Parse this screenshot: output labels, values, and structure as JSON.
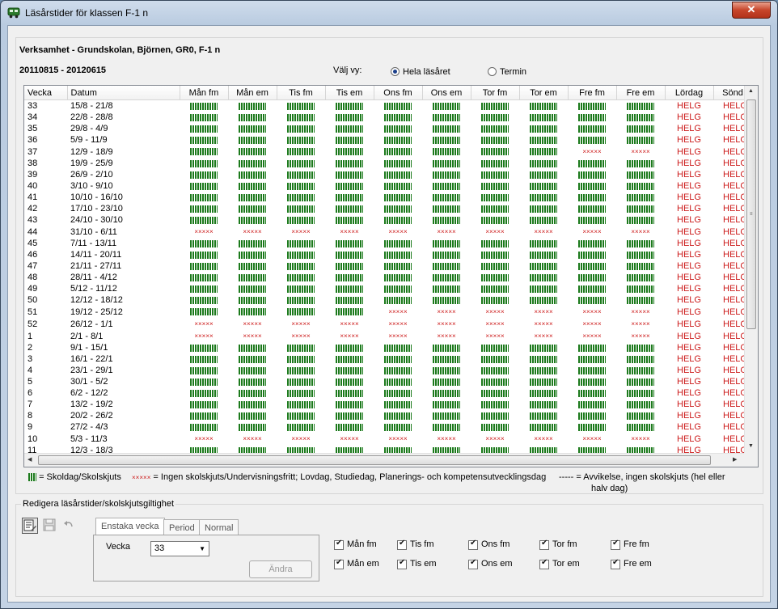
{
  "window": {
    "title": "Läsårstider för klassen F-1 n",
    "close": "✕"
  },
  "header": {
    "org": "Verksamhet - Grundskolan, Björnen, GR0, F-1 n",
    "range": "20110815 - 20120615",
    "view_label": "Välj vy:",
    "view_full": "Hela läsåret",
    "view_term": "Termin"
  },
  "table": {
    "columns": [
      "Vecka",
      "Datum",
      "Mån fm",
      "Mån em",
      "Tis fm",
      "Tis em",
      "Ons fm",
      "Ons em",
      "Tor fm",
      "Tor em",
      "Fre fm",
      "Fre em",
      "Lördag",
      "Sönd"
    ],
    "helg": "HELG",
    "rows": [
      {
        "w": "33",
        "d": "15/8 - 21/8",
        "s": "SSSSSSSSSS"
      },
      {
        "w": "34",
        "d": "22/8 - 28/8",
        "s": "SSSSSSSSSS"
      },
      {
        "w": "35",
        "d": "29/8 - 4/9",
        "s": "SSSSSSSSSS"
      },
      {
        "w": "36",
        "d": "5/9 - 11/9",
        "s": "SSSSSSSSSS"
      },
      {
        "w": "37",
        "d": "12/9 - 18/9",
        "s": "SSSSSSSSXX"
      },
      {
        "w": "38",
        "d": "19/9 - 25/9",
        "s": "SSSSSSSSSS"
      },
      {
        "w": "39",
        "d": "26/9 - 2/10",
        "s": "SSSSSSSSSS"
      },
      {
        "w": "40",
        "d": "3/10 - 9/10",
        "s": "SSSSSSSSSS"
      },
      {
        "w": "41",
        "d": "10/10 - 16/10",
        "s": "SSSSSSSSSS"
      },
      {
        "w": "42",
        "d": "17/10 - 23/10",
        "s": "SSSSSSSSSS"
      },
      {
        "w": "43",
        "d": "24/10 - 30/10",
        "s": "SSSSSSSSSS"
      },
      {
        "w": "44",
        "d": "31/10 - 6/11",
        "s": "XXXXXXXXXX"
      },
      {
        "w": "45",
        "d": "7/11 - 13/11",
        "s": "SSSSSSSSSS"
      },
      {
        "w": "46",
        "d": "14/11 - 20/11",
        "s": "SSSSSSSSSS"
      },
      {
        "w": "47",
        "d": "21/11 - 27/11",
        "s": "SSSSSSSSSS"
      },
      {
        "w": "48",
        "d": "28/11 - 4/12",
        "s": "SSSSSSSSSS"
      },
      {
        "w": "49",
        "d": "5/12 - 11/12",
        "s": "SSSSSSSSSS"
      },
      {
        "w": "50",
        "d": "12/12 - 18/12",
        "s": "SSSSSSSSSS"
      },
      {
        "w": "51",
        "d": "19/12 - 25/12",
        "s": "SSSSXXXXXX"
      },
      {
        "w": "52",
        "d": "26/12 - 1/1",
        "s": "XXXXXXXXXX"
      },
      {
        "w": "1",
        "d": "2/1 - 8/1",
        "s": "XXXXXXXXXX"
      },
      {
        "w": "2",
        "d": "9/1 - 15/1",
        "s": "SSSSSSSSSS"
      },
      {
        "w": "3",
        "d": "16/1 - 22/1",
        "s": "SSSSSSSSSS"
      },
      {
        "w": "4",
        "d": "23/1 - 29/1",
        "s": "SSSSSSSSSS"
      },
      {
        "w": "5",
        "d": "30/1 - 5/2",
        "s": "SSSSSSSSSS"
      },
      {
        "w": "6",
        "d": "6/2 - 12/2",
        "s": "SSSSSSSSSS"
      },
      {
        "w": "7",
        "d": "13/2 - 19/2",
        "s": "SSSSSSSSSS"
      },
      {
        "w": "8",
        "d": "20/2 - 26/2",
        "s": "SSSSSSSSSS"
      },
      {
        "w": "9",
        "d": "27/2 - 4/3",
        "s": "SSSSSSSSSS"
      },
      {
        "w": "10",
        "d": "5/3 - 11/3",
        "s": "XXXXXXXXXX"
      },
      {
        "w": "11",
        "d": "12/3 - 18/3",
        "s": "SSSSSSSSSS"
      }
    ]
  },
  "legend": {
    "school": "= Skoldag/Skolskjuts",
    "x_marks": "×××××",
    "x_text": "= Ingen skolskjuts/Undervisningsfritt; Lovdag, Studiedag, Planerings- och kompetensutvecklingsdag",
    "dash_marks": "-----",
    "dash_text_1": "= Avvikelse, ingen skolskjuts (hel eller",
    "dash_text_2": "halv dag)"
  },
  "edit": {
    "title": "Redigera läsårstider/skolskjutsgiltighet",
    "tabs": [
      "Enstaka vecka",
      "Period",
      "Normal"
    ],
    "vecka_label": "Vecka",
    "vecka_value": "33",
    "change_button": "Ändra",
    "checks": [
      "Mån fm",
      "Tis fm",
      "Ons fm",
      "Tor fm",
      "Fre fm",
      "Mån em",
      "Tis em",
      "Ons em",
      "Tor em",
      "Fre em"
    ]
  }
}
